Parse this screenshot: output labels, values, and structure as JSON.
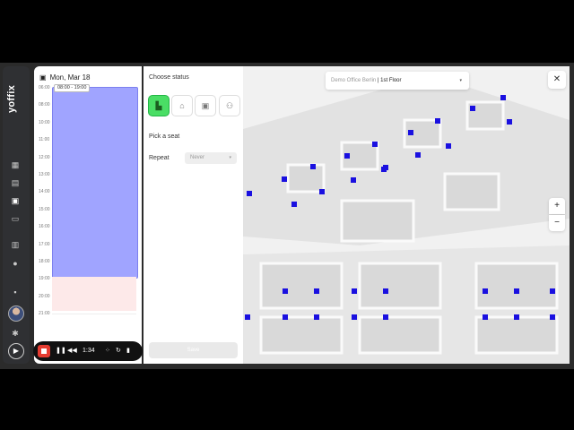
{
  "sidebar": {
    "logo": "yoffix",
    "icons": [
      "layout-icon",
      "book-icon",
      "calendar-icon",
      "chat-icon",
      "building-icon",
      "people-icon",
      "inbox-icon",
      "gear-icon"
    ]
  },
  "calendar": {
    "date": "Mon, Mar 18",
    "hours": [
      "06:00",
      "08:00",
      "10:00",
      "11:00",
      "12:00",
      "13:00",
      "14:00",
      "15:00",
      "16:00",
      "17:00",
      "18:00",
      "19:00",
      "20:00",
      "21:00"
    ],
    "event_label": "08:00 - 19:00"
  },
  "player": {
    "time": "1:34"
  },
  "panel": {
    "choose_status": "Choose status",
    "pick_seat": "Pick a seat",
    "repeat_label": "Repeat",
    "repeat_value": "Never",
    "save_label": "Save"
  },
  "map": {
    "office": "Demo Office Berlin",
    "floor": "1st Floor",
    "zoom_in": "+",
    "zoom_out": "−",
    "close": "✕",
    "seat_color": "#1a10e0"
  }
}
